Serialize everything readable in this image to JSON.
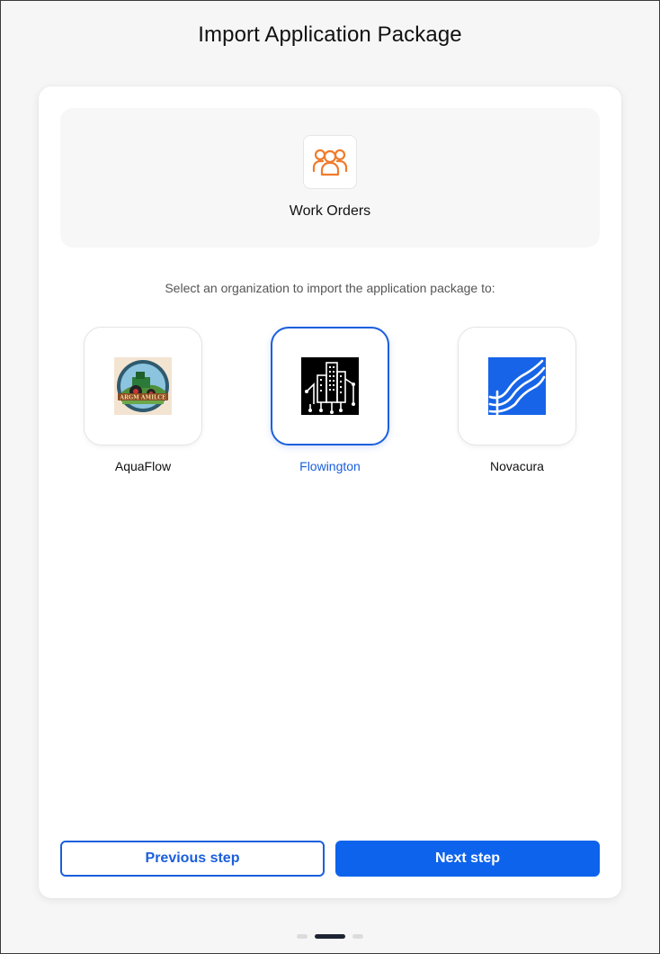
{
  "page": {
    "title": "Import Application Package"
  },
  "application": {
    "name": "Work Orders",
    "icon": "group-people-icon",
    "icon_color": "#f07b2b"
  },
  "instruction": "Select an organization to import the application package to:",
  "organizations": [
    {
      "name": "AquaFlow",
      "logo": "tractor-badge-logo",
      "logo_text": "ARGM AMILCE",
      "selected": false
    },
    {
      "name": "Flowington",
      "logo": "city-circuit-logo",
      "selected": true
    },
    {
      "name": "Novacura",
      "logo": "waves-logo",
      "selected": false
    }
  ],
  "buttons": {
    "previous": "Previous step",
    "next": "Next step"
  },
  "stepper": {
    "current": 2,
    "total": 3
  },
  "colors": {
    "accent": "#1a5fdc",
    "primary_button": "#0d63ec",
    "novacura_blue": "#1764e8"
  }
}
